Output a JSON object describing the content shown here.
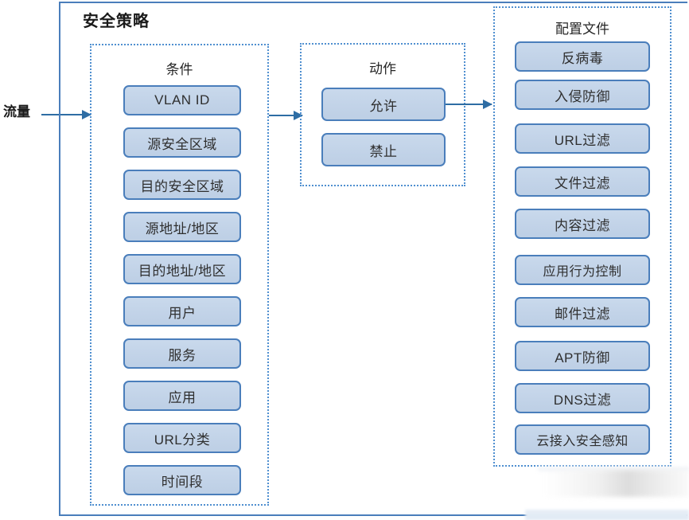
{
  "diagram": {
    "flow_label": "流量",
    "policy_frame_title": "安全策略",
    "colors": {
      "chip_fill": "#c4d4e8",
      "chip_border": "#4a7ebb",
      "group_border": "#4f8fd0",
      "frame_border": "#4a7ebb",
      "arrow": "#2e6da4"
    },
    "groups": [
      {
        "id": "conditions",
        "title": "条件",
        "items": [
          "VLAN ID",
          "源安全区域",
          "目的安全区域",
          "源地址/地区",
          "目的地址/地区",
          "用户",
          "服务",
          "应用",
          "URL分类",
          "时间段"
        ]
      },
      {
        "id": "actions",
        "title": "动作",
        "items": [
          "允许",
          "禁止"
        ]
      },
      {
        "id": "profiles",
        "title": "配置文件",
        "items": [
          "反病毒",
          "入侵防御",
          "URL过滤",
          "文件过滤",
          "内容过滤",
          "应用行为控制",
          "邮件过滤",
          "APT防御",
          "DNS过滤",
          "云接入安全感知"
        ]
      }
    ],
    "arrows": [
      {
        "id": "traffic-to-conditions"
      },
      {
        "id": "conditions-to-actions"
      },
      {
        "id": "actions-to-profiles"
      }
    ]
  }
}
